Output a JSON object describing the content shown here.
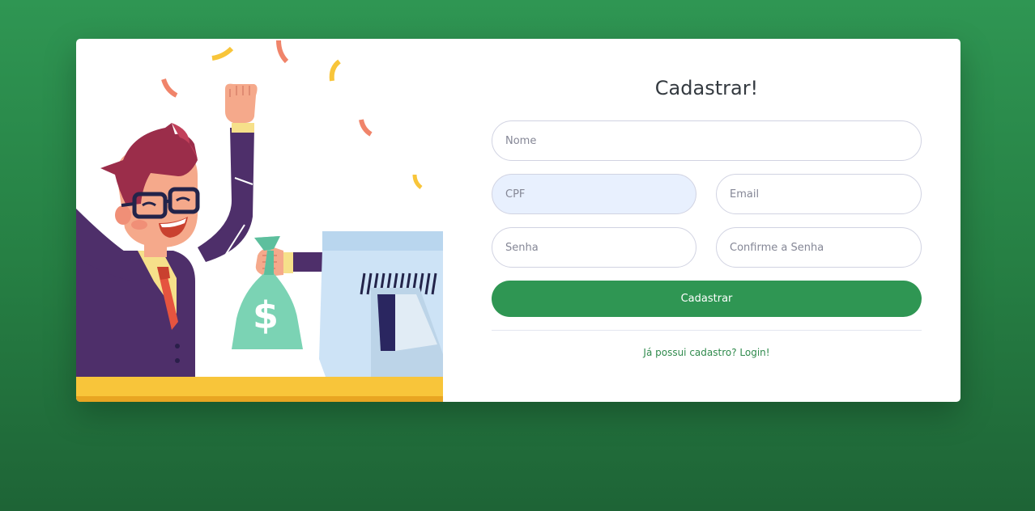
{
  "form": {
    "title": "Cadastrar!",
    "nome_placeholder": "Nome",
    "cpf_placeholder": "CPF",
    "email_placeholder": "Email",
    "senha_placeholder": "Senha",
    "confirm_placeholder": "Confirme a Senha",
    "submit_label": "Cadastrar",
    "login_link": "Já possui cadastro? Login!"
  },
  "colors": {
    "background": "#2f9653",
    "primary_button": "#2f9653",
    "link": "#2f8a4c",
    "autofill_field": "#e8f0fe"
  },
  "icons": {
    "illustration": "businessman-money-bag-illustration"
  }
}
